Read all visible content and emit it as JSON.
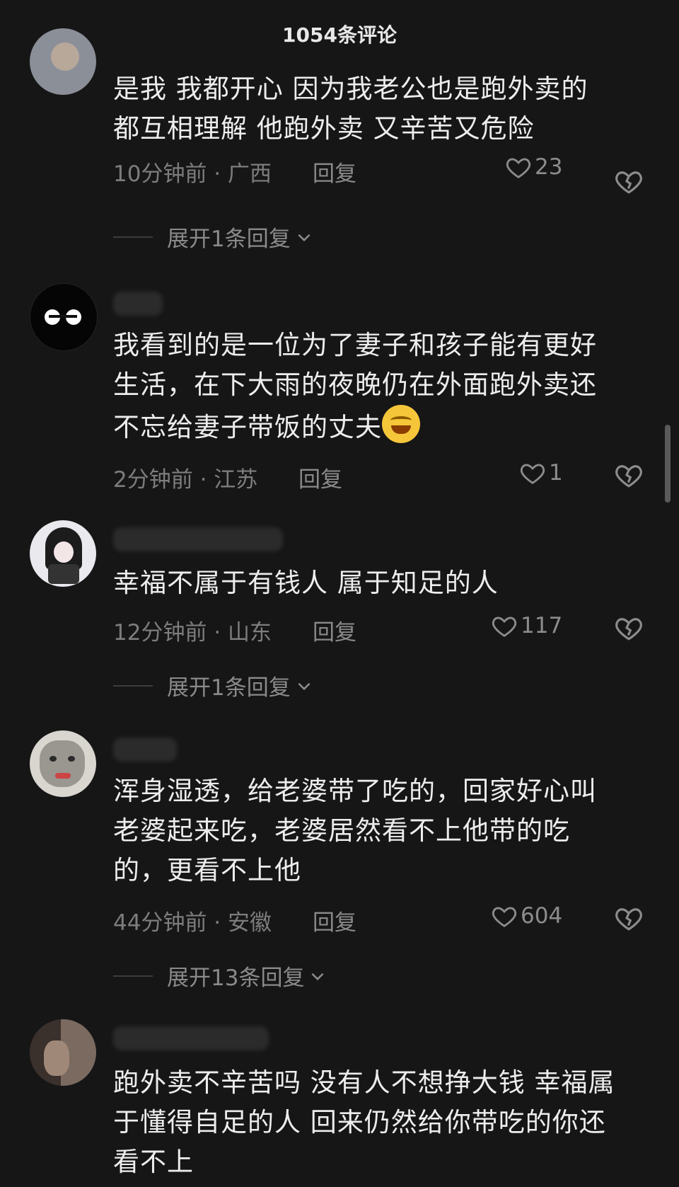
{
  "header": {
    "title": "1054条评论"
  },
  "comments": [
    {
      "text_lines": [
        "是我 我都开心 因为我老公也是跑外卖的",
        "都互相理解 他跑外卖 又辛苦又危险"
      ],
      "time": "10分钟前",
      "location": "广西",
      "reply_label": "回复",
      "likes": "23",
      "expand_label": "展开1条回复"
    },
    {
      "text_lines": [
        "我看到的是一位为了妻子和孩子能有更好",
        "生活，在下大雨的夜晚仍在外面跑外卖还",
        "不忘给妻子带饭的丈夫"
      ],
      "time": "2分钟前",
      "location": "江苏",
      "reply_label": "回复",
      "likes": "1"
    },
    {
      "text_lines": [
        "幸福不属于有钱人 属于知足的人"
      ],
      "time": "12分钟前",
      "location": "山东",
      "reply_label": "回复",
      "likes": "117",
      "expand_label": "展开1条回复"
    },
    {
      "text_lines": [
        "浑身湿透，给老婆带了吃的，回家好心叫",
        "老婆起来吃，老婆居然看不上他带的吃",
        "的，更看不上他"
      ],
      "time": "44分钟前",
      "location": "安徽",
      "reply_label": "回复",
      "likes": "604",
      "expand_label": "展开13条回复"
    },
    {
      "text_lines": [
        "跑外卖不辛苦吗 没有人不想挣大钱 幸福属",
        "于懂得自足的人 回来仍然给你带吃的你还",
        "看不上"
      ]
    }
  ],
  "icons": {
    "like": "heart-outline-icon",
    "dislike": "broken-heart-icon",
    "expand": "chevron-down-icon",
    "emoji": "grinning-sweat-emoji-icon"
  }
}
